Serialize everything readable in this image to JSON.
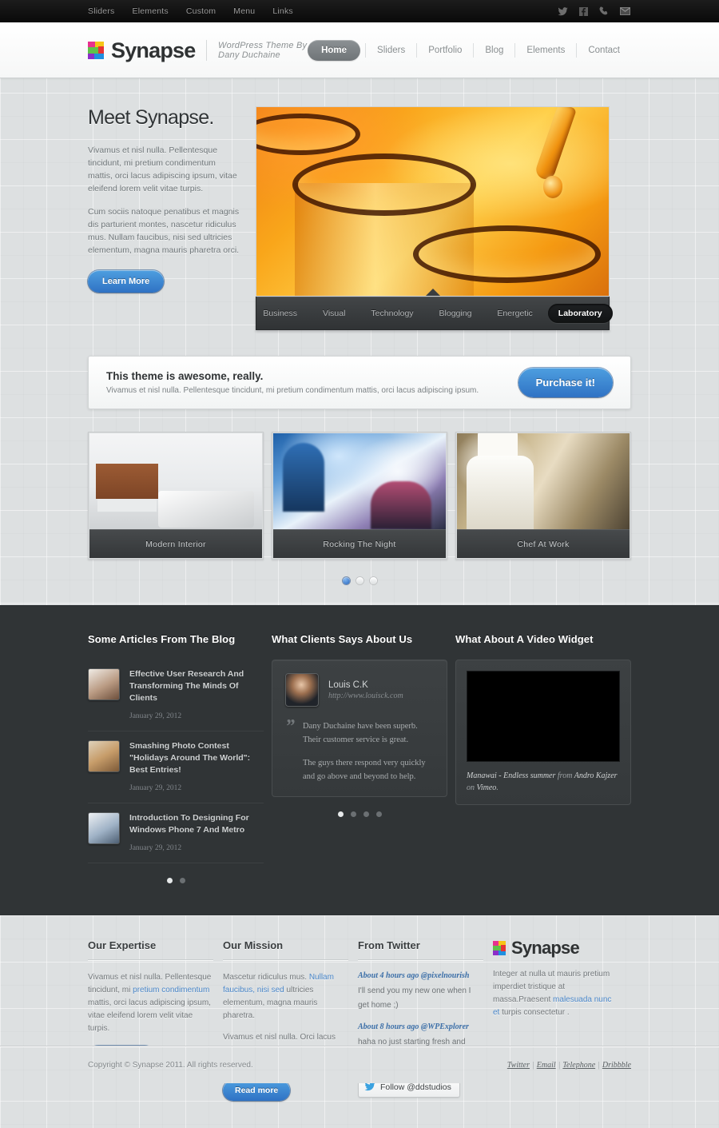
{
  "topbar": {
    "nav": [
      {
        "label": "Sliders"
      },
      {
        "label": "Elements"
      },
      {
        "label": "Custom"
      },
      {
        "label": "Menu"
      },
      {
        "label": "Links"
      }
    ],
    "social": [
      {
        "icon": "twitter-icon"
      },
      {
        "icon": "facebook-icon"
      },
      {
        "icon": "phone-icon"
      },
      {
        "icon": "email-icon"
      }
    ]
  },
  "header": {
    "logo_text": "Synapse",
    "tagline": "WordPress Theme By Dany Duchaine",
    "nav": [
      {
        "label": "Home",
        "active": true
      },
      {
        "label": "Sliders",
        "active": false
      },
      {
        "label": "Portfolio",
        "active": false
      },
      {
        "label": "Blog",
        "active": false
      },
      {
        "label": "Elements",
        "active": false
      },
      {
        "label": "Contact",
        "active": false
      }
    ]
  },
  "hero": {
    "title": "Meet Synapse.",
    "paragraph1": "Vivamus et nisl nulla. Pellentesque tincidunt, mi pretium condimentum mattis, orci lacus adipiscing ipsum, vitae eleifend lorem velit vitae turpis.",
    "paragraph2": "Cum sociis natoque penatibus et magnis dis parturient montes, nascetur ridiculus mus. Nullam faucibus, nisi sed ultricies elementum, magna mauris pharetra orci.",
    "button_label": "Learn More",
    "slide_image_alt": "laboratory-beakers-dropper-photo",
    "tabs": [
      {
        "label": "Business",
        "active": false
      },
      {
        "label": "Visual",
        "active": false
      },
      {
        "label": "Technology",
        "active": false
      },
      {
        "label": "Blogging",
        "active": false
      },
      {
        "label": "Energetic",
        "active": false
      },
      {
        "label": "Laboratory",
        "active": true
      }
    ]
  },
  "callout": {
    "title": "This theme is awesome, really.",
    "subtitle": "Vivamus et nisl nulla. Pellentesque tincidunt, mi pretium condimentum mattis, orci lacus adipiscing ipsum.",
    "button_label": "Purchase it!"
  },
  "portfolio": {
    "items": [
      {
        "caption": "Modern Interior",
        "image_alt": "modern-kitchen-interior-photo"
      },
      {
        "caption": "Rocking The Night",
        "image_alt": "concert-crowd-photo"
      },
      {
        "caption": "Chef At Work",
        "image_alt": "chef-plating-food-photo"
      }
    ],
    "pager": {
      "count": 3,
      "active_index": 0
    }
  },
  "dark_section": {
    "blog": {
      "title": "Some Articles From The Blog",
      "articles": [
        {
          "title": "Effective User Research And Transforming The Minds Of Clients",
          "date": "January 29, 2012",
          "thumb_alt": "article-thumb-person"
        },
        {
          "title": "Smashing Photo Contest \"Holidays Around The World\": Best Entries!",
          "date": "January 29, 2012",
          "thumb_alt": "article-thumb-desert"
        },
        {
          "title": "Introduction To Designing For Windows Phone 7 And Metro",
          "date": "January 29, 2012",
          "thumb_alt": "article-thumb-people"
        }
      ],
      "pager": {
        "count": 2,
        "active_index": 0
      }
    },
    "testimonials": {
      "title": "What Clients Says About Us",
      "author": "Louis C.K",
      "url": "http://www.louisck.com",
      "quote_mark": "”",
      "paragraph1": "Dany Duchaine have been superb. Their customer service is great.",
      "paragraph2": "The guys there respond very quickly and go above and beyond to help.",
      "pager": {
        "count": 4,
        "active_index": 0
      }
    },
    "video": {
      "title": "What About A Video Widget",
      "caption_main": "Manawai - Endless summer",
      "caption_from": " from ",
      "caption_author": "Andro Kajzer",
      "caption_on": " on ",
      "caption_site": "Vimeo",
      "caption_end": "."
    }
  },
  "footer_widgets": {
    "expertise": {
      "title": "Our Expertise",
      "text_a": "Vivamus et nisl nulla. Pellentesque tincidunt, mi ",
      "link_a": "pretium condimentum",
      "text_b": " mattis, orci lacus adipiscing ipsum, vitae eleifend lorem velit vitae turpis.",
      "button_label": "Read more"
    },
    "mission": {
      "title": "Our Mission",
      "text_a": "Mascetur ridiculus mus. ",
      "link_a": "Nullam faucibus, nisi sed",
      "text_b": " ultricies elementum, magna mauris pharetra.",
      "paragraph2": "Vivamus et nisl nulla. Orci lacus adipiscing ipsum, vitae eleifend lorem velit vitae turpis.",
      "button_label": "Read more"
    },
    "twitter": {
      "title": "From Twitter",
      "tweets": [
        {
          "meta": "About 4 hours ago @pixelnourish",
          "text": "I'll send you my new one when I get home ;)"
        },
        {
          "meta": "About 8 hours ago @WPExplorer",
          "text": "haha no just starting fresh and alone this time ;)"
        }
      ],
      "follow_label": "Follow @ddstudios"
    },
    "brand": {
      "logo_text": "Synapse",
      "text_a": "Integer at nulla ut mauris pretium imperdiet tristique at massa.Praesent ",
      "link_a": "malesuada nunc et",
      "text_b": " turpis consectetur ."
    }
  },
  "bottombar": {
    "copyright": "Copyright © Synapse 2011. All rights reserved.",
    "links": [
      {
        "label": "Twitter"
      },
      {
        "label": "Email"
      },
      {
        "label": "Telephone"
      },
      {
        "label": "Dribbble"
      }
    ],
    "separator": "|"
  },
  "colors": {
    "accent_blue": "#2f72c4",
    "dark_section": "#303436",
    "page_bg": "#dde0e1",
    "topbar": "#141414"
  }
}
